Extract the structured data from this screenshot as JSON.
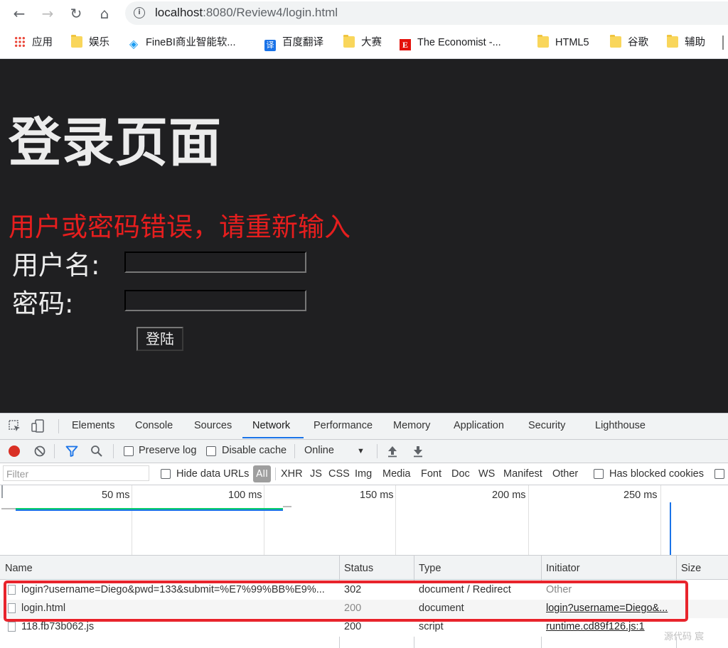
{
  "browser": {
    "url_host": "localhost",
    "url_rest": ":8080/Review4/login.html"
  },
  "bookmarks": [
    {
      "label": "应用",
      "icon": "apps-grid-icon"
    },
    {
      "label": "娱乐",
      "icon": "folder-icon"
    },
    {
      "label": "FineBI商业智能软...",
      "icon": "finebi-icon"
    },
    {
      "label": "百度翻译",
      "icon": "translate-icon"
    },
    {
      "label": "大赛",
      "icon": "folder-icon"
    },
    {
      "label": "The Economist -...",
      "icon": "economist-icon"
    },
    {
      "label": "HTML5",
      "icon": "folder-icon"
    },
    {
      "label": "谷歌",
      "icon": "folder-icon"
    },
    {
      "label": "辅助",
      "icon": "folder-icon"
    }
  ],
  "page": {
    "title": "登录页面",
    "error": "用户或密码错误，请重新输入",
    "username_label": "用户名:",
    "password_label": "密码:",
    "login_button": "登陆"
  },
  "devtools": {
    "tabs": [
      "Elements",
      "Console",
      "Sources",
      "Network",
      "Performance",
      "Memory",
      "Application",
      "Security",
      "Lighthouse"
    ],
    "active_tab": "Network",
    "toolbar": {
      "preserve_log": "Preserve log",
      "disable_cache": "Disable cache",
      "throttle": "Online"
    },
    "filter": {
      "placeholder": "Filter",
      "hide_data_urls": "Hide data URLs",
      "types": [
        "All",
        "XHR",
        "JS",
        "CSS",
        "Img",
        "Media",
        "Font",
        "Doc",
        "WS",
        "Manifest",
        "Other"
      ],
      "has_blocked_cookies": "Has blocked cookies"
    },
    "timeline": {
      "ticks": [
        "50 ms",
        "100 ms",
        "150 ms",
        "200 ms",
        "250 ms"
      ]
    },
    "columns": [
      "Name",
      "Status",
      "Type",
      "Initiator",
      "Size"
    ],
    "rows": [
      {
        "name": "login?username=Diego&pwd=133&submit=%E7%99%BB%E9%...",
        "status": "302",
        "type": "document / Redirect",
        "initiator": "Other"
      },
      {
        "name": "login.html",
        "status": "200",
        "type": "document",
        "initiator": "login?username=Diego&..."
      },
      {
        "name": "118.fb73b062.js",
        "status": "200",
        "type": "script",
        "initiator": "runtime.cd89f126.js:1"
      }
    ]
  },
  "watermark": "源代码  宸"
}
